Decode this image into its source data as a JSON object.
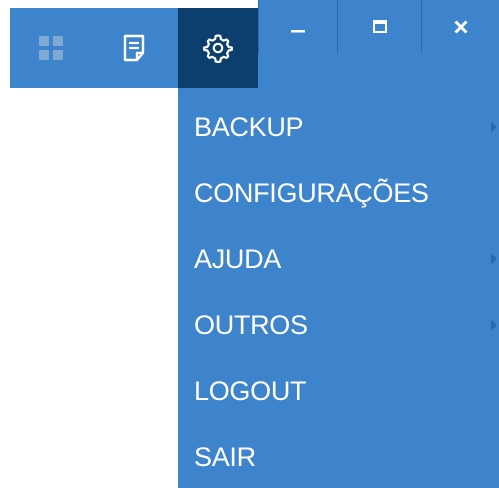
{
  "toolbar": {
    "dashboard_icon": "dashboard-grid-icon",
    "notes_icon": "document-icon",
    "settings_icon": "gear-icon"
  },
  "window_controls": {
    "minimize_label": "–",
    "maximize_label": "🗖",
    "close_label": "✕"
  },
  "settings_menu": {
    "items": [
      {
        "label": "BACKUP",
        "has_submenu": true
      },
      {
        "label": "CONFIGURAÇÕES",
        "has_submenu": false
      },
      {
        "label": "AJUDA",
        "has_submenu": true
      },
      {
        "label": "OUTROS",
        "has_submenu": true
      },
      {
        "label": "LOGOUT",
        "has_submenu": false
      },
      {
        "label": "SAIR",
        "has_submenu": false
      }
    ]
  },
  "colors": {
    "primary_blue": "#3d84cc",
    "active_navy": "#0d3f6e",
    "text_white": "#ffffff"
  }
}
